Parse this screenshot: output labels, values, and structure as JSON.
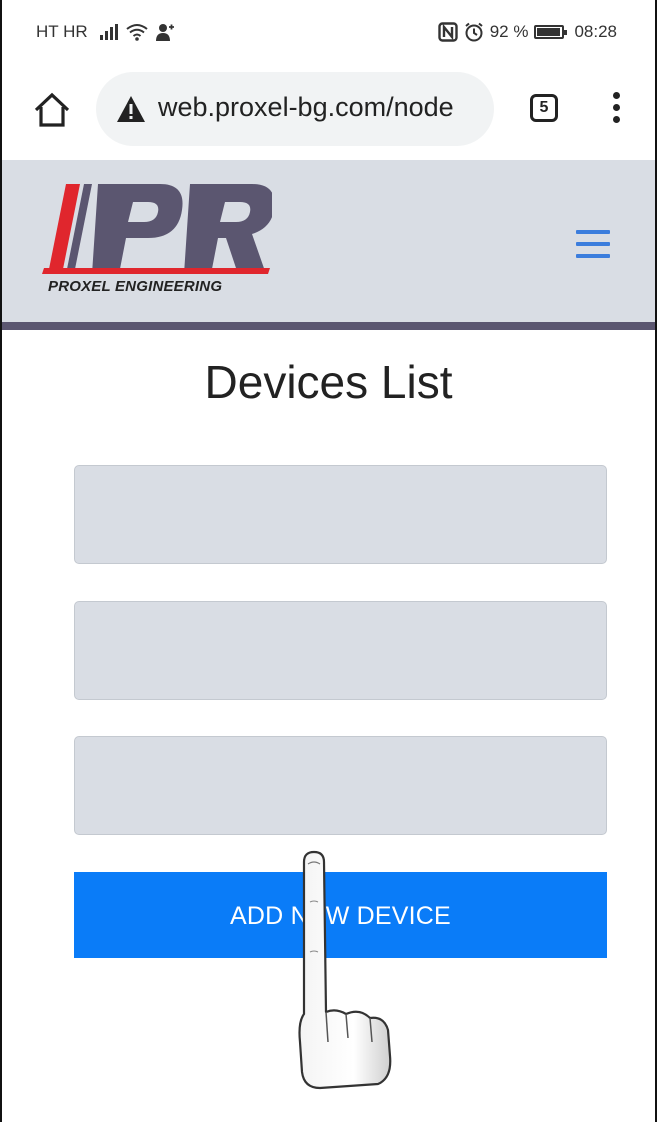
{
  "status_bar": {
    "carrier": "HT HR",
    "battery_percent": "92 %",
    "time": "08:28"
  },
  "browser": {
    "url": "web.proxel-bg.com/node",
    "tab_count": "5"
  },
  "site": {
    "logo_text": "PROXEL ENGINEERING",
    "brand_color": "#5b5670",
    "accent_red": "#e0262d"
  },
  "page": {
    "title": "Devices List",
    "fields": [
      {
        "value": ""
      },
      {
        "value": ""
      },
      {
        "value": ""
      }
    ],
    "add_button_label": "ADD NEW DEVICE",
    "button_color": "#0a7cf8"
  },
  "icons": [
    "home-icon",
    "warning-icon",
    "tabs-icon",
    "overflow-menu-icon",
    "hamburger-menu-icon",
    "pointing-hand-icon",
    "signal-icon",
    "wifi-icon",
    "battery-icon",
    "nfc-icon",
    "alarm-icon"
  ]
}
